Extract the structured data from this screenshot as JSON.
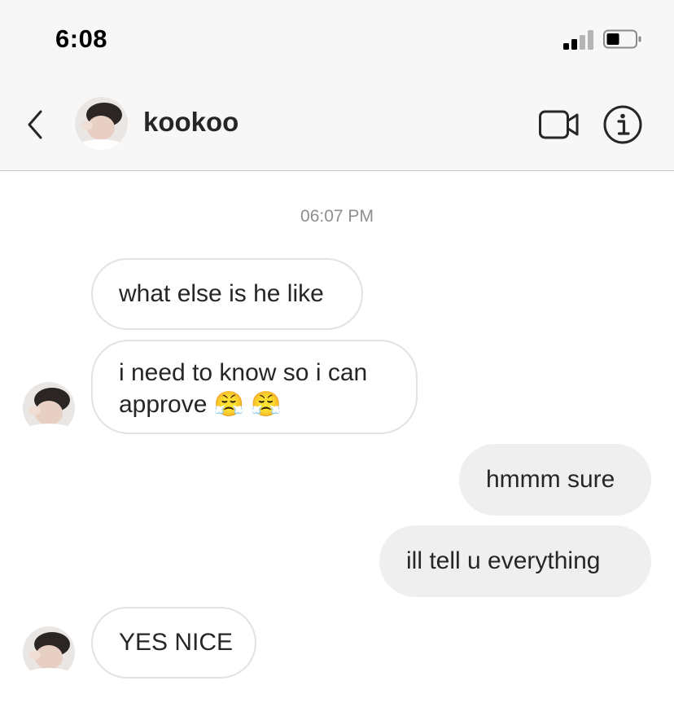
{
  "status_bar": {
    "time": "6:08",
    "signal_icon": "cellular-signal-icon",
    "battery_icon": "battery-icon"
  },
  "header": {
    "back_icon": "chevron-left-icon",
    "username": "kookoo",
    "video_icon": "video-camera-icon",
    "info_icon": "info-icon"
  },
  "thread": {
    "timestamp": "06:07 PM",
    "messages": [
      {
        "direction": "incoming",
        "text": "what else is he like"
      },
      {
        "direction": "incoming",
        "text_line1": "i need to know so i can",
        "text_line2": "approve 😤 😤"
      },
      {
        "direction": "outgoing",
        "text": "hmmm sure"
      },
      {
        "direction": "outgoing",
        "text": "ill tell u everything"
      },
      {
        "direction": "incoming",
        "text": "YES NICE"
      }
    ]
  },
  "colors": {
    "bar_background": "#f7f7f7",
    "incoming_border": "#e2e2e2",
    "outgoing_background": "#efefef",
    "timestamp_text": "#8e8e8e"
  }
}
